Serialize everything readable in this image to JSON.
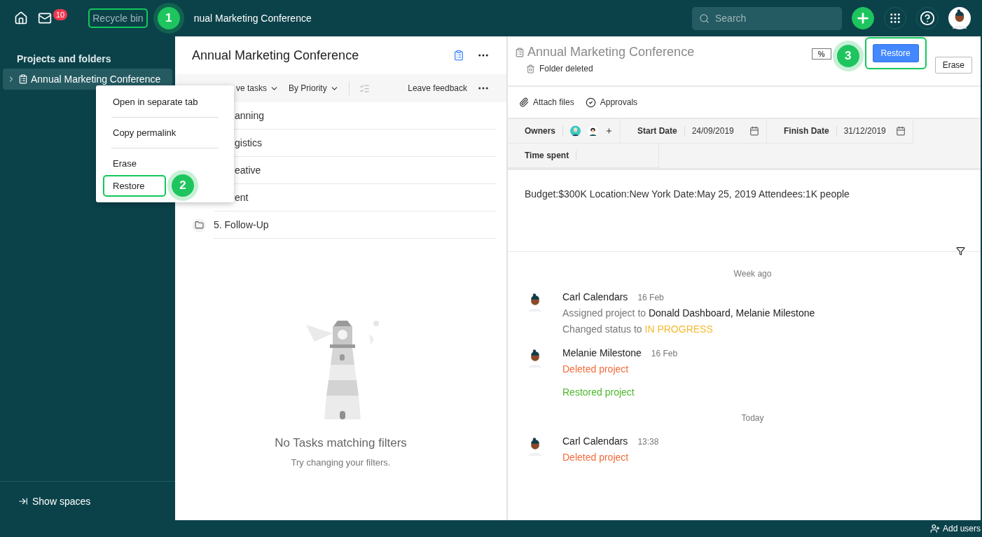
{
  "topbar": {
    "mail_count": "10",
    "breadcrumb": [
      {
        "label": "Recycle bin",
        "highlighted": true,
        "callout": "1"
      },
      {
        "label": "nual Marketing Conference",
        "highlighted": false
      }
    ],
    "search": {
      "placeholder": "Search"
    }
  },
  "sidebar": {
    "heading": "Projects and folders",
    "items": [
      {
        "label": "Annual Marketing Conference",
        "selected": true
      }
    ],
    "footer": "Show spaces"
  },
  "context_menu": {
    "items": [
      {
        "label": "Open in separate tab",
        "divider_after": true,
        "highlighted": false
      },
      {
        "label": "Copy permalink",
        "divider_after": true,
        "highlighted": false
      },
      {
        "label": "Erase",
        "divider_after": false,
        "highlighted": false
      },
      {
        "label": "Restore",
        "divider_after": false,
        "highlighted": true,
        "callout": "2"
      }
    ]
  },
  "task_panel": {
    "title": "Annual Marketing Conference",
    "toolbar": {
      "filter": "ve tasks",
      "sort": "By Priority",
      "feedback": "Leave feedback"
    },
    "rows": [
      {
        "kind": "cut",
        "label": "anning"
      },
      {
        "kind": "cut",
        "label": "gistics"
      },
      {
        "kind": "cut",
        "label": "eative"
      },
      {
        "kind": "cut",
        "label": "ent"
      },
      {
        "kind": "folder",
        "label": "5. Follow-Up"
      }
    ],
    "empty": {
      "title": "No Tasks matching filters",
      "hint": "Try changing your filters."
    }
  },
  "details": {
    "title": "Annual Marketing Conference",
    "status": "Folder deleted",
    "percent": "%",
    "callout": "3",
    "buttons": [
      {
        "label": "Restore",
        "kind": "primary",
        "highlighted": true
      },
      {
        "label": "Erase",
        "kind": "plain",
        "highlighted": false
      }
    ],
    "actions": [
      {
        "label": "Attach files",
        "kind": "attach"
      },
      {
        "label": "Approvals",
        "kind": "approve"
      }
    ],
    "fields": [
      {
        "label": "Owners",
        "kind": "owners"
      },
      {
        "label": "Start Date",
        "kind": "date",
        "value": "24/09/2019"
      },
      {
        "label": "Finish Date",
        "kind": "date",
        "value": "31/12/2019"
      },
      {
        "label": "Time spent",
        "kind": "empty"
      }
    ],
    "description": "Budget:$300K Location:New York Date:May 25, 2019 Attendees:1K people"
  },
  "activity": [
    {
      "kind": "divider",
      "label": "Week ago"
    },
    {
      "kind": "entry",
      "author": "Carl Calendars",
      "time": "16 Feb",
      "lines": [
        {
          "text": "Assigned project to",
          "accent": "Donald Dashboard, Melanie Milestone"
        },
        {
          "text": "Changed status to",
          "accent": "IN PROGRESS",
          "color": "#f5b82e"
        }
      ]
    },
    {
      "kind": "entry",
      "author": "Melanie Milestone",
      "time": "16 Feb",
      "lines": [
        {
          "text": "Deleted project",
          "color": "#f26b3a"
        },
        {
          "text": "Restored project",
          "color": "#4cb82c",
          "spaced": true
        }
      ]
    },
    {
      "kind": "divider",
      "label": "Today"
    },
    {
      "kind": "entry",
      "author": "Carl Calendars",
      "time": "13:38",
      "lines": [
        {
          "text": "Deleted project",
          "color": "#f26b3a"
        }
      ]
    }
  ],
  "status_bar": {
    "action": "Add users"
  }
}
